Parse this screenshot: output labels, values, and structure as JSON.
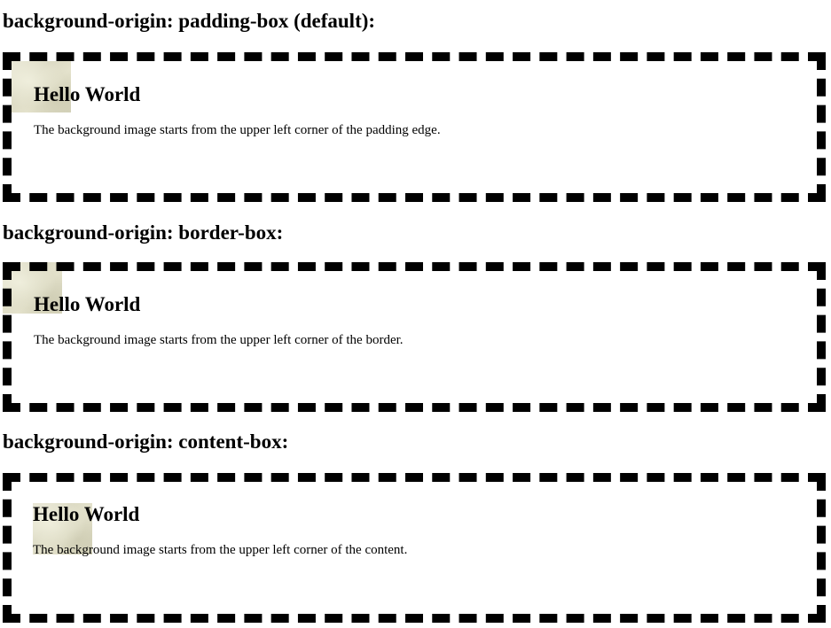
{
  "sections": [
    {
      "title": "background-origin: padding-box (default):",
      "heading": "Hello World",
      "text": "The background image starts from the upper left corner of the padding edge."
    },
    {
      "title": "background-origin: border-box:",
      "heading": "Hello World",
      "text": "The background image starts from the upper left corner of the border."
    },
    {
      "title": "background-origin: content-box:",
      "heading": "Hello World",
      "text": "The background image starts from the upper left corner of the content."
    }
  ],
  "colors": {
    "text": "#000000",
    "border": "#000000",
    "background": "#ffffff",
    "paper_texture": "#e2e0ca"
  }
}
